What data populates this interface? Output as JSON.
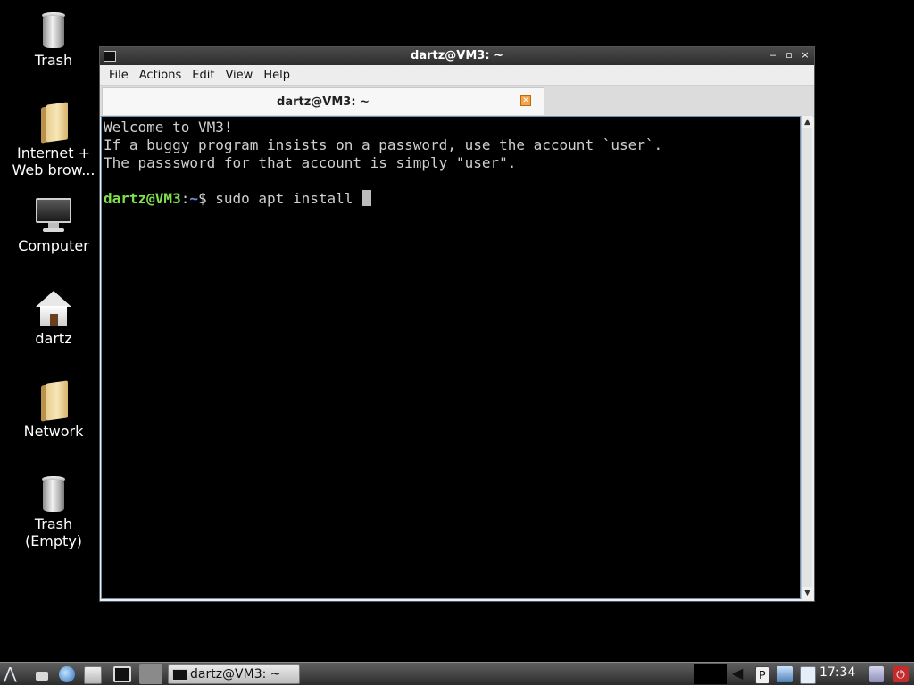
{
  "desktop": {
    "icons": [
      {
        "label_line1": "Trash",
        "label_line2": ""
      },
      {
        "label_line1": "Internet +",
        "label_line2": "Web brow..."
      },
      {
        "label_line1": "Computer",
        "label_line2": ""
      },
      {
        "label_line1": "dartz",
        "label_line2": ""
      },
      {
        "label_line1": "Network",
        "label_line2": ""
      },
      {
        "label_line1": "Trash",
        "label_line2": "(Empty)"
      }
    ]
  },
  "window": {
    "title": "dartz@VM3: ~",
    "controls": {
      "minimize": "‒",
      "maximize": "▫",
      "close": "×"
    },
    "menu": [
      "File",
      "Actions",
      "Edit",
      "View",
      "Help"
    ],
    "tab": {
      "title": "dartz@VM3: ~",
      "close_glyph": "✕"
    },
    "terminal": {
      "lines": [
        "Welcome to VM3!",
        "If a buggy program insists on a password, use the account `user`.",
        "The passsword for that account is simply \"user\"."
      ],
      "prompt_user": "dartz@VM3",
      "prompt_sep": ":",
      "prompt_path": "~",
      "prompt_symbol": "$ ",
      "command": "sudo apt install "
    }
  },
  "taskbar": {
    "task_label": "dartz@VM3: ~",
    "clock": "17:34"
  },
  "colors": {
    "prompt_user": "#7ee04a",
    "prompt_path": "#6f8fd6",
    "terminal_bg": "#000000",
    "terminal_fg": "#cfcfcf"
  }
}
